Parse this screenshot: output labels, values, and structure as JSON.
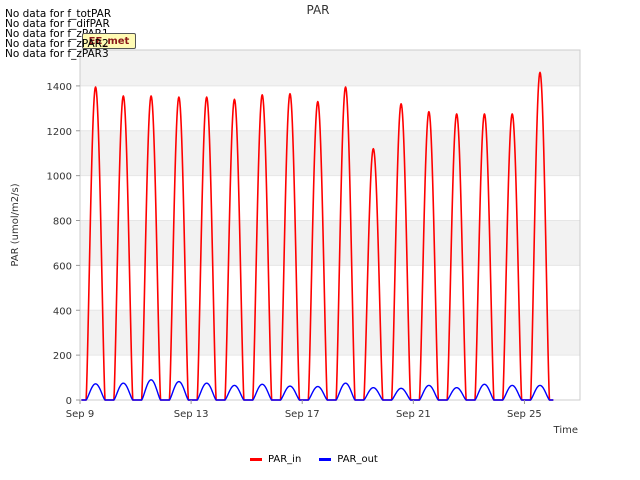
{
  "no_data_messages": [
    "No data for f_totPAR",
    "No data for f_difPAR",
    "No data for f_zPAR1",
    "No data for f_zPAR2",
    "No data for f_zPAR3"
  ],
  "badge_text": "EE_met",
  "colors": {
    "PAR_in": "#ff0000",
    "PAR_out": "#0000ff",
    "band": "#f2f2f2",
    "grid": "#ffffff"
  },
  "chart_data": {
    "type": "line",
    "title": "PAR",
    "xlabel": "Time",
    "ylabel": "PAR (umol/m2/s)",
    "ylim": [
      0,
      1560
    ],
    "yticks": [
      0,
      200,
      400,
      600,
      800,
      1000,
      1200,
      1400
    ],
    "xlim": [
      "2016-09-09",
      "2016-09-27"
    ],
    "xticks": [
      {
        "date": "2016-09-09",
        "label": "Sep 9"
      },
      {
        "date": "2016-09-13",
        "label": "Sep 13"
      },
      {
        "date": "2016-09-17",
        "label": "Sep 17"
      },
      {
        "date": "2016-09-21",
        "label": "Sep 21"
      },
      {
        "date": "2016-09-25",
        "label": "Sep 25"
      }
    ],
    "legend_placement": "bottom-center",
    "series": [
      {
        "name": "PAR_in",
        "daily_peak_dates": [
          "2016-09-09",
          "2016-09-10",
          "2016-09-11",
          "2016-09-12",
          "2016-09-13",
          "2016-09-14",
          "2016-09-15",
          "2016-09-16",
          "2016-09-17",
          "2016-09-18",
          "2016-09-19",
          "2016-09-20",
          "2016-09-21",
          "2016-09-22",
          "2016-09-23",
          "2016-09-24",
          "2016-09-25"
        ],
        "daily_peaks": [
          1395,
          1355,
          1355,
          1350,
          1350,
          1340,
          1360,
          1365,
          1330,
          1395,
          1120,
          1320,
          1285,
          1275,
          1275,
          1275,
          1460
        ]
      },
      {
        "name": "PAR_out",
        "daily_peak_dates": [
          "2016-09-09",
          "2016-09-10",
          "2016-09-11",
          "2016-09-12",
          "2016-09-13",
          "2016-09-14",
          "2016-09-15",
          "2016-09-16",
          "2016-09-17",
          "2016-09-18",
          "2016-09-19",
          "2016-09-20",
          "2016-09-21",
          "2016-09-22",
          "2016-09-23",
          "2016-09-24",
          "2016-09-25"
        ],
        "daily_peaks": [
          72,
          75,
          90,
          82,
          75,
          65,
          70,
          62,
          60,
          75,
          55,
          52,
          65,
          55,
          70,
          65,
          65
        ]
      }
    ]
  }
}
